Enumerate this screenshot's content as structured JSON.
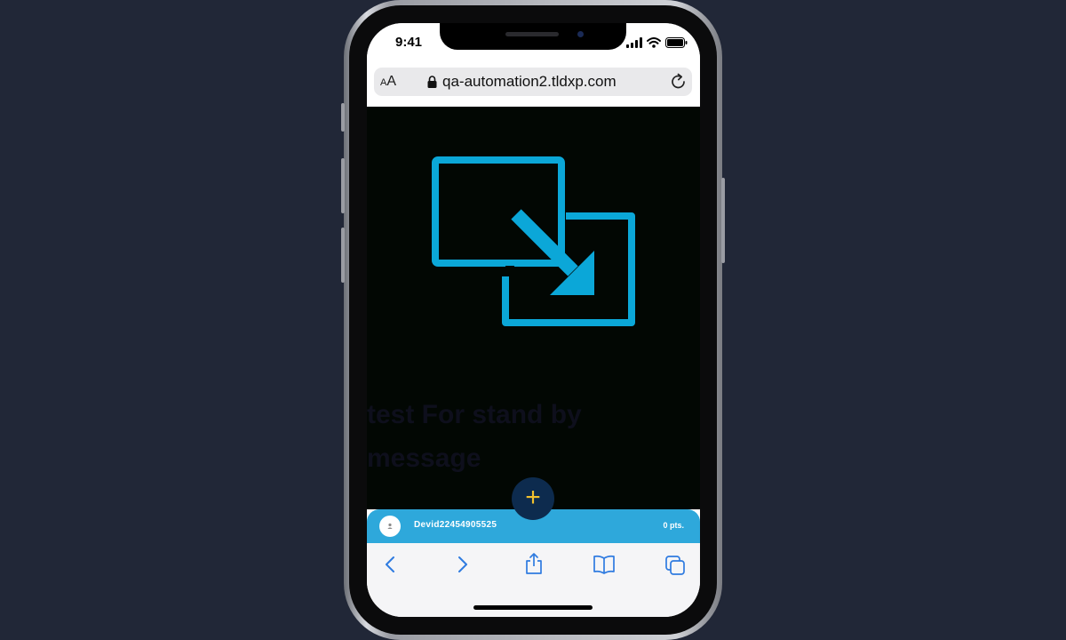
{
  "status_bar": {
    "time": "9:41"
  },
  "browser": {
    "text_size_small": "A",
    "text_size_large": "A",
    "url": "qa-automation2.tldxp.com"
  },
  "page": {
    "message": "test For stand by message",
    "fab_label": "+"
  },
  "user_bar": {
    "username": "Devid22454905525",
    "points": "0 pts."
  },
  "colors": {
    "background": "#212737",
    "content_background": "#020703",
    "accent": "#0ba7d8",
    "user_bar": "#2ea8db",
    "fab": "#0d2b4e",
    "fab_plus": "#f2c12e",
    "toolbar_icons": "#2f7be0"
  },
  "icons": {
    "hero": "window-minimize-icon",
    "toolbar": [
      "back-icon",
      "forward-icon",
      "share-icon",
      "bookmarks-icon",
      "tabs-icon"
    ]
  }
}
